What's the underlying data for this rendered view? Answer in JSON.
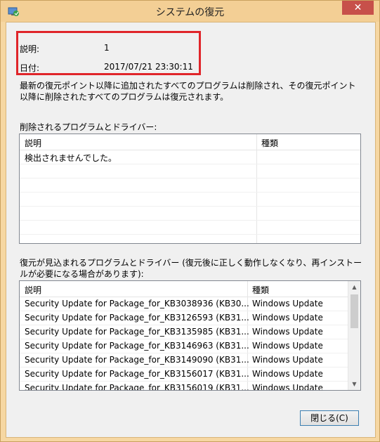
{
  "window": {
    "title": "システムの復元",
    "close_glyph": "✕"
  },
  "info": {
    "description_label": "説明:",
    "description_value": "1",
    "date_label": "日付:",
    "date_value": "2017/07/21 23:30:11"
  },
  "intro_text": "最新の復元ポイント以降に追加されたすべてのプログラムは削除され、その復元ポイント以降に削除されたすべてのプログラムは復元されます。",
  "deleted_section": {
    "label": "削除されるプログラムとドライバー:",
    "columns": [
      "説明",
      "種類"
    ],
    "rows": [
      {
        "description": "検出されませんでした。",
        "type": ""
      }
    ]
  },
  "restored_section": {
    "label": "復元が見込まれるプログラムとドライバー (復元後に正しく動作しなくなり、再インストールが必要になる場合があります):",
    "columns": [
      "説明",
      "種類"
    ],
    "rows": [
      {
        "description": "Security Update for Package_for_KB3038936 (KB30...",
        "type": "Windows Update"
      },
      {
        "description": "Security Update for Package_for_KB3126593 (KB31...",
        "type": "Windows Update"
      },
      {
        "description": "Security Update for Package_for_KB3135985 (KB31...",
        "type": "Windows Update"
      },
      {
        "description": "Security Update for Package_for_KB3146963 (KB31...",
        "type": "Windows Update"
      },
      {
        "description": "Security Update for Package_for_KB3149090 (KB31...",
        "type": "Windows Update"
      },
      {
        "description": "Security Update for Package_for_KB3156017 (KB31...",
        "type": "Windows Update"
      },
      {
        "description": "Security Update for Package_for_KB3156019 (KB31...",
        "type": "Windows Update"
      }
    ]
  },
  "buttons": {
    "close_label": "閉じる(C)"
  }
}
